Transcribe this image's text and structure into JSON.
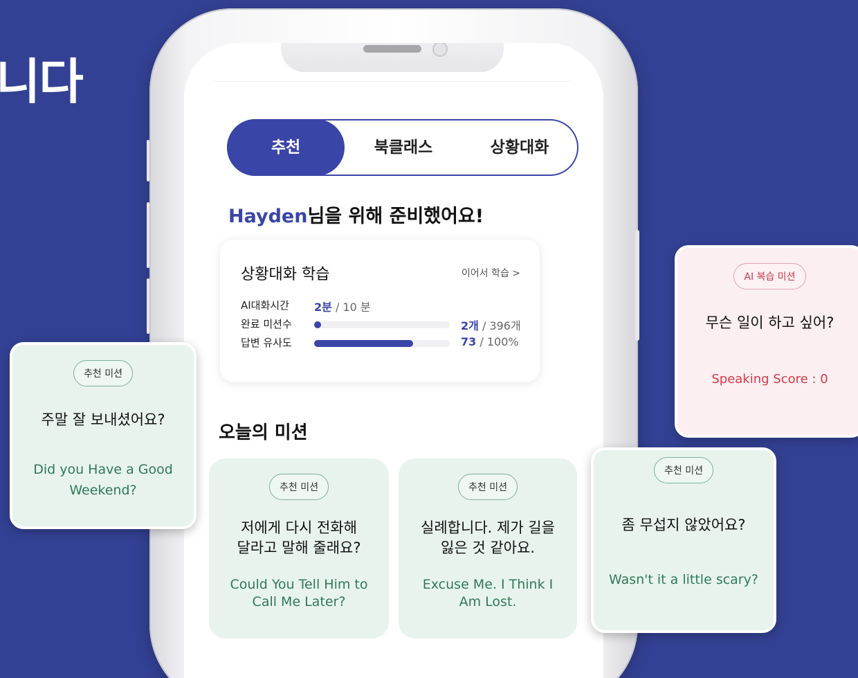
{
  "hero": {
    "title_fragment": "니다"
  },
  "tabs": [
    {
      "label": "추천",
      "active": true
    },
    {
      "label": "북클래스",
      "active": false
    },
    {
      "label": "상황대화",
      "active": false
    }
  ],
  "greeting": {
    "name": "Hayden",
    "suffix": "님을 위해 준비했어요!"
  },
  "study": {
    "title": "상황대화 학습",
    "continue_label": "이어서 학습 >",
    "stats": [
      {
        "label": "AI대화시간",
        "value": "2분",
        "total": " / 10 분"
      },
      {
        "label": "완료 미션수",
        "value": "2개",
        "total": " / 396개",
        "progress": 0.005
      },
      {
        "label": "답변 유사도",
        "value": "73",
        "total": " / 100%",
        "progress": 0.73
      }
    ]
  },
  "missions": {
    "heading": "오늘의 미션",
    "cards": [
      {
        "tag": "추천 미션",
        "korean": "저에게 다시 전화해\n달라고 말해 줄래요?",
        "english": "Could You Tell Him to\nCall Me Later?"
      },
      {
        "tag": "추천 미션",
        "korean": "실례합니다. 제가 길을\n잃은 것 같아요.",
        "english": "Excuse Me. I Think I\nAm Lost."
      }
    ]
  },
  "floating": {
    "left": {
      "tag": "추천 미션",
      "korean": "주말 잘 보내셨어요?",
      "english": "Did you Have a Good\nWeekend?"
    },
    "review": {
      "tag": "AI 복습 미션",
      "korean": "무슨 일이 하고 싶어?",
      "score": "Speaking Score : 0"
    },
    "scary": {
      "tag": "추천 미션",
      "korean": "좀 무섭지 않았어요?",
      "english": "Wasn't it a little scary?"
    }
  },
  "colors": {
    "background": "#334194",
    "accent": "#3a45a8",
    "mission_green": "#2f7a56",
    "score_red": "#d23a4b"
  }
}
